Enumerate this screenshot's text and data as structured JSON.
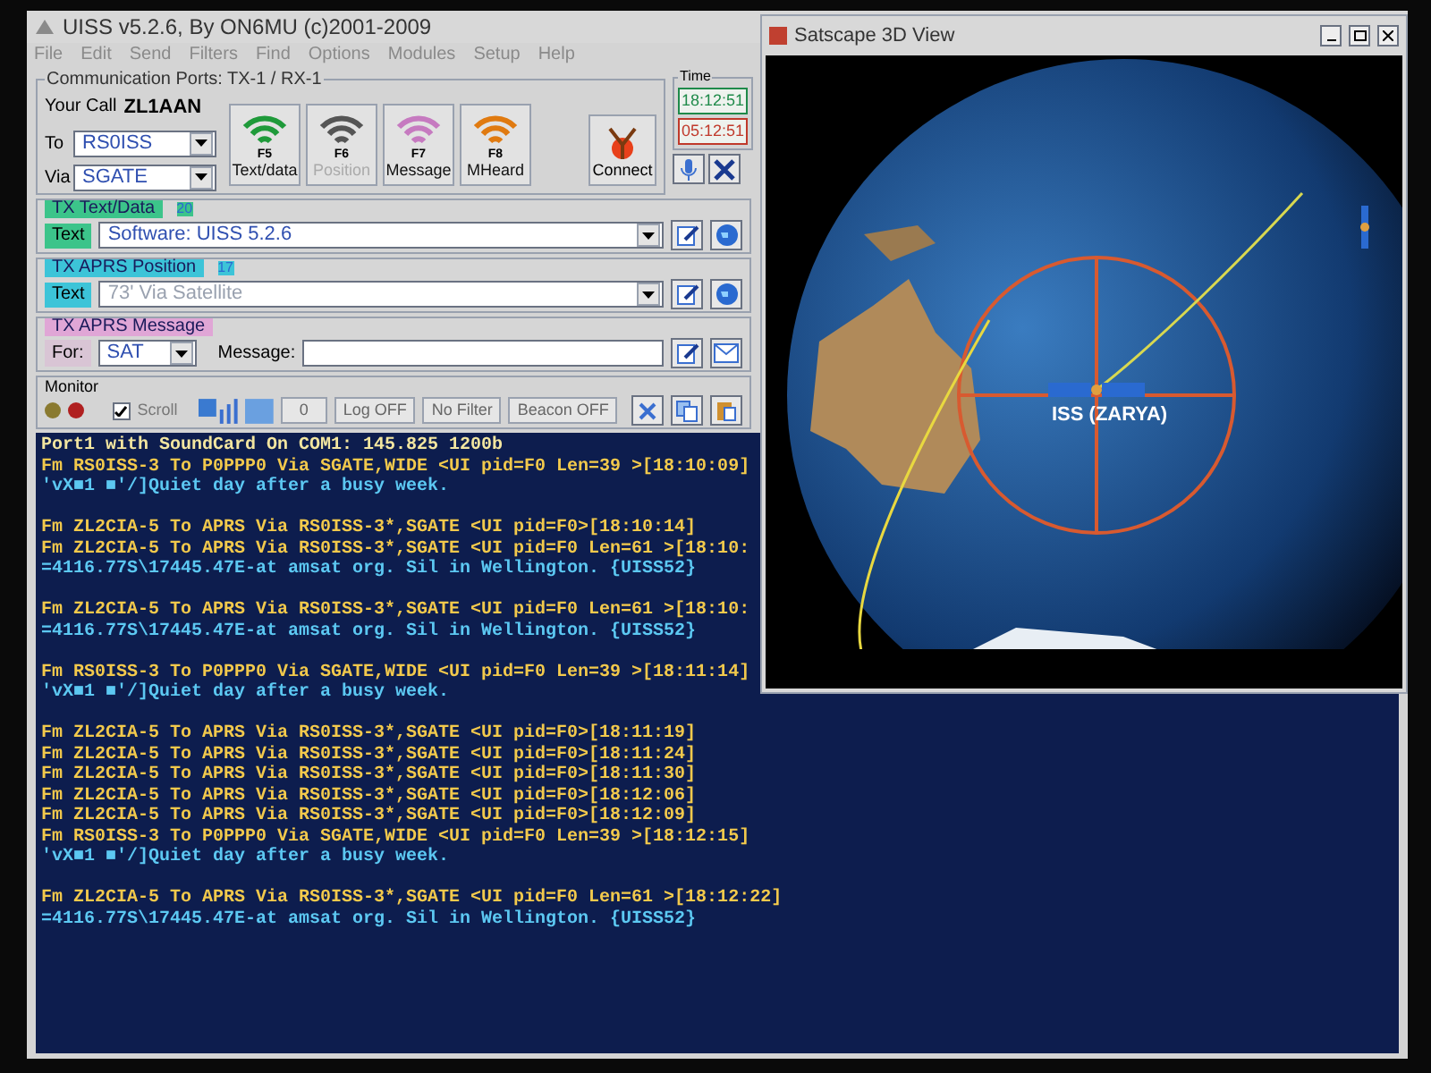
{
  "uiss_window": {
    "title": "UISS v5.2.6, By ON6MU (c)2001-2009",
    "menu": [
      "File",
      "Edit",
      "Send",
      "Filters",
      "Find",
      "Options",
      "Modules",
      "Setup",
      "Help"
    ],
    "comm": {
      "legend": "Communication Ports: TX-1 / RX-1",
      "your_call_label": "Your Call",
      "callsign": "ZL1AAN",
      "to_label": "To",
      "to_value": "RS0ISS",
      "via_label": "Via",
      "via_value": "SGATE"
    },
    "mode_buttons": [
      {
        "key": "F5",
        "label": "Text/data",
        "color": "#1f9a3a",
        "disabled": false
      },
      {
        "key": "F6",
        "label": "Position",
        "color": "#555555",
        "disabled": true
      },
      {
        "key": "F7",
        "label": "Message",
        "color": "#c67ac0",
        "disabled": false
      },
      {
        "key": "F8",
        "label": "MHeard",
        "color": "#e07a10",
        "disabled": false
      }
    ],
    "connect_label": "Connect",
    "time": {
      "legend": "Time",
      "clocks": [
        {
          "value": "18:12:51",
          "color": "#1f8a4a"
        },
        {
          "value": "05:12:51",
          "color": "#c0392b"
        }
      ]
    },
    "tx_panels": [
      {
        "kind": "text",
        "title": "TX Text/Data",
        "count": "20",
        "color": "#3cc48a",
        "prefix": "Text",
        "value": "Software: UISS 5.2.6",
        "disabled": false
      },
      {
        "kind": "text",
        "title": "TX APRS Position",
        "count": "17",
        "color": "#3cc4d8",
        "prefix": "Text",
        "value": "73' Via Satellite",
        "disabled": true
      },
      {
        "kind": "message",
        "title": "TX APRS Message",
        "color": "#e0a6d6",
        "for_label": "For:",
        "for_value": "SAT",
        "message_label": "Message:"
      }
    ],
    "monitor": {
      "legend": "Monitor",
      "scroll_label": "Scroll",
      "scroll_checked": true,
      "fields": [
        "0",
        "Log OFF",
        "No Filter",
        "Beacon OFF"
      ]
    },
    "terminal": [
      {
        "kind": "status",
        "text": "Port1 with SoundCard On COM1: 145.825 1200b"
      },
      {
        "kind": "frame",
        "text": "Fm RS0ISS-3 To P0PPP0 Via SGATE,WIDE <UI pid=F0 Len=39 >[18:10:09]"
      },
      {
        "kind": "data",
        "text": "'vX■1 ■'/]Quiet day after a busy week."
      },
      {
        "kind": "blank"
      },
      {
        "kind": "frame",
        "text": "Fm ZL2CIA-5 To APRS Via RS0ISS-3*,SGATE <UI pid=F0>[18:10:14]"
      },
      {
        "kind": "frame",
        "text": "Fm ZL2CIA-5 To APRS Via RS0ISS-3*,SGATE <UI pid=F0 Len=61 >[18:10:"
      },
      {
        "kind": "data",
        "text": "=4116.77S\\17445.47E-at amsat org. Sil in Wellington. {UISS52}"
      },
      {
        "kind": "blank"
      },
      {
        "kind": "frame",
        "text": "Fm ZL2CIA-5 To APRS Via RS0ISS-3*,SGATE <UI pid=F0 Len=61 >[18:10:"
      },
      {
        "kind": "data",
        "text": "=4116.77S\\17445.47E-at amsat org. Sil in Wellington. {UISS52}"
      },
      {
        "kind": "blank"
      },
      {
        "kind": "frame",
        "text": "Fm RS0ISS-3 To P0PPP0 Via SGATE,WIDE <UI pid=F0 Len=39 >[18:11:14]"
      },
      {
        "kind": "data",
        "text": "'vX■1 ■'/]Quiet day after a busy week."
      },
      {
        "kind": "blank"
      },
      {
        "kind": "frame",
        "text": "Fm ZL2CIA-5 To APRS Via RS0ISS-3*,SGATE <UI pid=F0>[18:11:19]"
      },
      {
        "kind": "frame",
        "text": "Fm ZL2CIA-5 To APRS Via RS0ISS-3*,SGATE <UI pid=F0>[18:11:24]"
      },
      {
        "kind": "frame",
        "text": "Fm ZL2CIA-5 To APRS Via RS0ISS-3*,SGATE <UI pid=F0>[18:11:30]"
      },
      {
        "kind": "frame",
        "text": "Fm ZL2CIA-5 To APRS Via RS0ISS-3*,SGATE <UI pid=F0>[18:12:06]"
      },
      {
        "kind": "frame",
        "text": "Fm ZL2CIA-5 To APRS Via RS0ISS-3*,SGATE <UI pid=F0>[18:12:09]"
      },
      {
        "kind": "frame",
        "text": "Fm RS0ISS-3 To P0PPP0 Via SGATE,WIDE <UI pid=F0 Len=39 >[18:12:15]"
      },
      {
        "kind": "data",
        "text": "'vX■1 ■'/]Quiet day after a busy week."
      },
      {
        "kind": "blank"
      },
      {
        "kind": "frame",
        "text": "Fm ZL2CIA-5 To APRS Via RS0ISS-3*,SGATE <UI pid=F0 Len=61 >[18:12:22]"
      },
      {
        "kind": "data",
        "text": "=4116.77S\\17445.47E-at amsat org. Sil in Wellington. {UISS52}"
      }
    ]
  },
  "satscape_window": {
    "title": "Satscape 3D View",
    "satellite_label": "ISS (ZARYA)"
  }
}
